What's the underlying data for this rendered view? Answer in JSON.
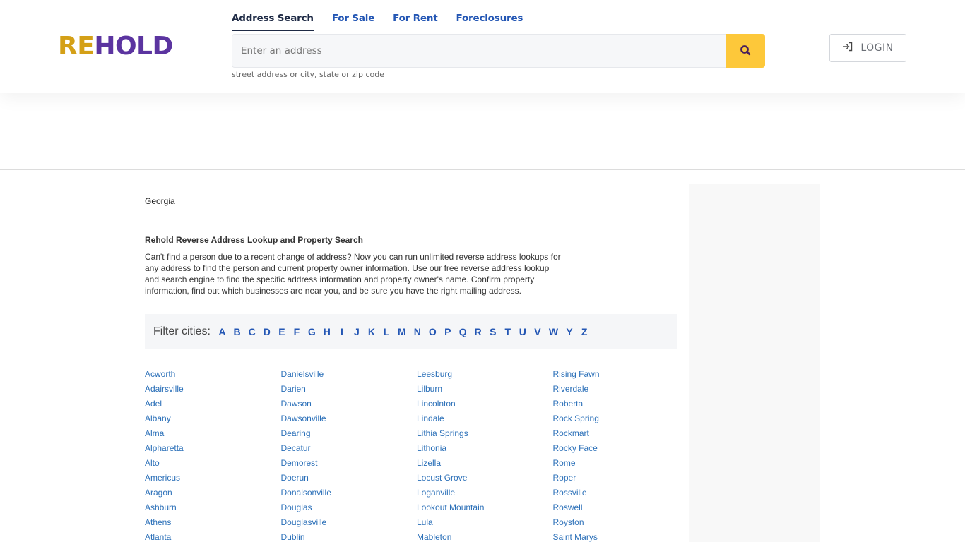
{
  "header": {
    "logo": {
      "part1": "RE",
      "part2": "HOLD"
    },
    "tabs": [
      {
        "label": "Address Search",
        "active": true
      },
      {
        "label": "For Sale",
        "active": false
      },
      {
        "label": "For Rent",
        "active": false
      },
      {
        "label": "Foreclosures",
        "active": false
      }
    ],
    "search": {
      "placeholder": "Enter an address",
      "value": "",
      "hint": "street address or city, state or zip code",
      "button_icon": "search-icon"
    },
    "login": {
      "label": "LOGIN",
      "icon": "login-icon"
    }
  },
  "colors": {
    "logo_gold": "#d4a017",
    "logo_purple": "#5b34a0",
    "search_button": "#fdc83a",
    "link_blue": "#2a6fb8",
    "tab_blue": "#2356b4"
  },
  "main": {
    "state": "Georgia",
    "title": "Rehold Reverse Address Lookup and Property Search",
    "description": "Can't find a person due to a recent change of address? Now you can run unlimited reverse address lookups for any address to find the person and current property owner information. Use our free reverse address lookup and search engine to find the specific address information and property owner's name. Confirm property information, find out which businesses are near you, and be sure you have the right mailing address.",
    "filter": {
      "label": "Filter cities:",
      "letters": [
        "A",
        "B",
        "C",
        "D",
        "E",
        "F",
        "G",
        "H",
        "I",
        "J",
        "K",
        "L",
        "M",
        "N",
        "O",
        "P",
        "Q",
        "R",
        "S",
        "T",
        "U",
        "V",
        "W",
        "Y",
        "Z"
      ]
    },
    "city_columns": [
      [
        "Acworth",
        "Adairsville",
        "Adel",
        "Albany",
        "Alma",
        "Alpharetta",
        "Alto",
        "Americus",
        "Aragon",
        "Ashburn",
        "Athens",
        "Atlanta"
      ],
      [
        "Danielsville",
        "Darien",
        "Dawson",
        "Dawsonville",
        "Dearing",
        "Decatur",
        "Demorest",
        "Doerun",
        "Donalsonville",
        "Douglas",
        "Douglasville",
        "Dublin"
      ],
      [
        "Leesburg",
        "Lilburn",
        "Lincolnton",
        "Lindale",
        "Lithia Springs",
        "Lithonia",
        "Lizella",
        "Locust Grove",
        "Loganville",
        "Lookout Mountain",
        "Lula",
        "Mableton"
      ],
      [
        "Rising Fawn",
        "Riverdale",
        "Roberta",
        "Rock Spring",
        "Rockmart",
        "Rocky Face",
        "Rome",
        "Roper",
        "Rossville",
        "Roswell",
        "Royston",
        "Saint Marys"
      ]
    ]
  }
}
